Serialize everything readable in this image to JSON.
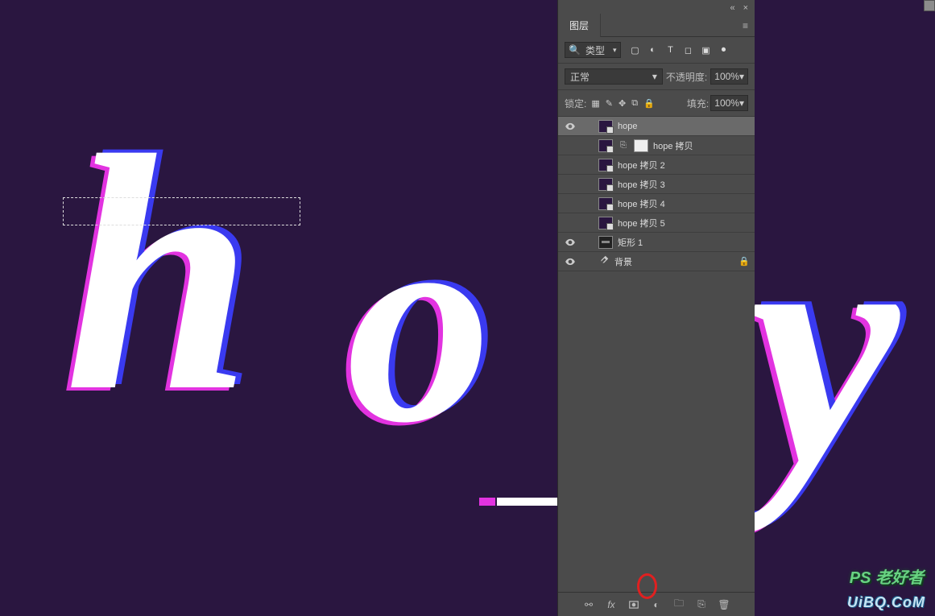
{
  "panel": {
    "collapse_tip": "«",
    "close_tip": "×",
    "tab_label": "图层",
    "filter": {
      "label": "类型",
      "icons": [
        "image",
        "adjust",
        "text",
        "shape",
        "smart"
      ]
    },
    "blend_mode": "正常",
    "opacity_label": "不透明度:",
    "opacity_value": "100%",
    "lock_label": "锁定:",
    "fill_label": "填充:",
    "fill_value": "100%"
  },
  "layers": [
    {
      "visible": true,
      "selected": true,
      "type": "smart",
      "name": "hope"
    },
    {
      "visible": false,
      "selected": false,
      "type": "smart_masked",
      "name": "hope 拷贝"
    },
    {
      "visible": false,
      "selected": false,
      "type": "smart",
      "name": "hope 拷贝  2"
    },
    {
      "visible": false,
      "selected": false,
      "type": "smart",
      "name": "hope 拷贝  3"
    },
    {
      "visible": false,
      "selected": false,
      "type": "smart",
      "name": "hope 拷贝  4"
    },
    {
      "visible": false,
      "selected": false,
      "type": "smart",
      "name": "hope 拷贝  5"
    },
    {
      "visible": true,
      "selected": false,
      "type": "shape",
      "name": "矩形 1"
    },
    {
      "visible": true,
      "selected": false,
      "type": "bg",
      "name": "背景",
      "locked": true
    }
  ],
  "footer": {
    "items": [
      "link",
      "fx",
      "mask",
      "adjust",
      "group",
      "new",
      "trash"
    ]
  },
  "watermark1": "PS 老好者",
  "watermark2": "UiBQ.CoM",
  "search_icon": "🔍"
}
